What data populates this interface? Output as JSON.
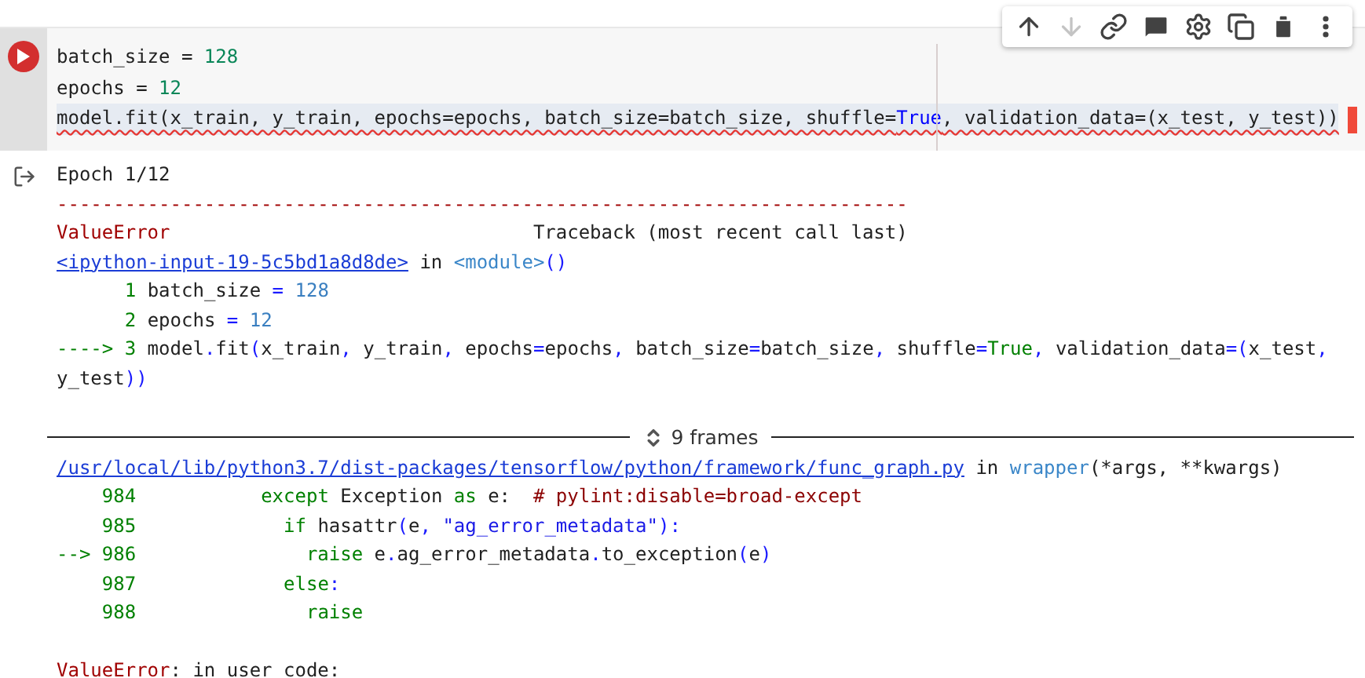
{
  "toolbar": [
    {
      "kind": "up",
      "disabled": false
    },
    {
      "kind": "down",
      "disabled": true
    },
    {
      "kind": "link",
      "disabled": false
    },
    {
      "kind": "comment",
      "disabled": false
    },
    {
      "kind": "settings",
      "disabled": false
    },
    {
      "kind": "mirror",
      "disabled": false
    },
    {
      "kind": "delete",
      "disabled": false
    },
    {
      "kind": "more",
      "disabled": false
    }
  ],
  "cell": {
    "lines": [
      {
        "highlighted": false,
        "squiggle": false,
        "segments": [
          {
            "text": "batch_size = ",
            "kind": "plain"
          },
          {
            "text": "128",
            "kind": "cnumber"
          }
        ]
      },
      {
        "highlighted": false,
        "squiggle": false,
        "segments": [
          {
            "text": "epochs = ",
            "kind": "plain"
          },
          {
            "text": "12",
            "kind": "cnumber"
          }
        ]
      },
      {
        "highlighted": true,
        "squiggle": true,
        "segments": [
          {
            "text": "model.fit(x_train, y_train, epochs=epochs, batch_size=batch_size, shuffle=",
            "kind": "plain"
          },
          {
            "text": "True",
            "kind": "cconst"
          },
          {
            "text": ", validation_data=(x_test, y_test))",
            "kind": "plain"
          }
        ]
      }
    ]
  },
  "output": {
    "lines": [
      {
        "kind": "code",
        "segments": [
          {
            "text": "Epoch 1/12",
            "kind": "plain"
          }
        ]
      },
      {
        "kind": "code",
        "segments": [
          {
            "text": "---------------------------------------------------------------------------",
            "kind": "error"
          }
        ]
      },
      {
        "kind": "code",
        "segments": [
          {
            "text": "ValueError",
            "kind": "error"
          },
          {
            "text": "                                Traceback (most recent call last)",
            "kind": "plain"
          }
        ]
      },
      {
        "kind": "code",
        "segments": [
          {
            "text": "<ipython-input-19-5c5bd1a8d8de>",
            "kind": "link"
          },
          {
            "text": " in ",
            "kind": "plain"
          },
          {
            "text": "<module>",
            "kind": "module"
          },
          {
            "text": "()",
            "kind": "op"
          }
        ]
      },
      {
        "kind": "code",
        "segments": [
          {
            "text": "      1",
            "kind": "lineno"
          },
          {
            "text": " batch_size ",
            "kind": "plain"
          },
          {
            "text": "=",
            "kind": "op"
          },
          {
            "text": " 128",
            "kind": "number"
          }
        ]
      },
      {
        "kind": "code",
        "segments": [
          {
            "text": "      2",
            "kind": "lineno"
          },
          {
            "text": " epochs ",
            "kind": "plain"
          },
          {
            "text": "=",
            "kind": "op"
          },
          {
            "text": " 12",
            "kind": "number"
          }
        ]
      },
      {
        "kind": "code",
        "segments": [
          {
            "text": "----> 3",
            "kind": "lineno"
          },
          {
            "text": " model",
            "kind": "plain"
          },
          {
            "text": ".",
            "kind": "op"
          },
          {
            "text": "fit",
            "kind": "plain"
          },
          {
            "text": "(",
            "kind": "op"
          },
          {
            "text": "x_train",
            "kind": "plain"
          },
          {
            "text": ",",
            "kind": "op"
          },
          {
            "text": " y_train",
            "kind": "plain"
          },
          {
            "text": ",",
            "kind": "op"
          },
          {
            "text": " epochs",
            "kind": "plain"
          },
          {
            "text": "=",
            "kind": "op"
          },
          {
            "text": "epochs",
            "kind": "plain"
          },
          {
            "text": ",",
            "kind": "op"
          },
          {
            "text": " batch_size",
            "kind": "plain"
          },
          {
            "text": "=",
            "kind": "op"
          },
          {
            "text": "batch_size",
            "kind": "plain"
          },
          {
            "text": ",",
            "kind": "op"
          },
          {
            "text": " shuffle",
            "kind": "plain"
          },
          {
            "text": "=",
            "kind": "op"
          },
          {
            "text": "True",
            "kind": "keyword"
          },
          {
            "text": ",",
            "kind": "op"
          },
          {
            "text": " validation_data",
            "kind": "plain"
          },
          {
            "text": "=",
            "kind": "op"
          },
          {
            "text": "(",
            "kind": "op"
          },
          {
            "text": "x_test",
            "kind": "plain"
          },
          {
            "text": ",",
            "kind": "op"
          },
          {
            "text": " y_test",
            "kind": "plain"
          },
          {
            "text": "))",
            "kind": "op"
          }
        ]
      },
      {
        "kind": "blank"
      },
      {
        "kind": "frames",
        "label": "9 frames"
      },
      {
        "kind": "code",
        "segments": [
          {
            "text": "/usr/local/lib/python3.7/dist-packages/tensorflow/python/framework/func_graph.py",
            "kind": "link"
          },
          {
            "text": " in ",
            "kind": "plain"
          },
          {
            "text": "wrapper",
            "kind": "module"
          },
          {
            "text": "(*args, **kwargs)",
            "kind": "plain"
          }
        ]
      },
      {
        "kind": "code",
        "segments": [
          {
            "text": "    984",
            "kind": "lineno"
          },
          {
            "text": "           except",
            "kind": "keyword"
          },
          {
            "text": " Exception ",
            "kind": "plain"
          },
          {
            "text": "as",
            "kind": "keyword"
          },
          {
            "text": " e:  ",
            "kind": "plain"
          },
          {
            "text": "# pylint:disable=broad-except",
            "kind": "comment"
          }
        ]
      },
      {
        "kind": "code",
        "segments": [
          {
            "text": "    985",
            "kind": "lineno"
          },
          {
            "text": "             if",
            "kind": "keyword"
          },
          {
            "text": " hasattr",
            "kind": "plain"
          },
          {
            "text": "(",
            "kind": "op"
          },
          {
            "text": "e",
            "kind": "plain"
          },
          {
            "text": ", ",
            "kind": "op"
          },
          {
            "text": "\"ag_error_metadata\"",
            "kind": "string"
          },
          {
            "text": "):",
            "kind": "op"
          }
        ]
      },
      {
        "kind": "code",
        "segments": [
          {
            "text": "--> 986",
            "kind": "lineno"
          },
          {
            "text": "               raise",
            "kind": "keyword"
          },
          {
            "text": " e",
            "kind": "plain"
          },
          {
            "text": ".",
            "kind": "op"
          },
          {
            "text": "ag_error_metadata",
            "kind": "plain"
          },
          {
            "text": ".",
            "kind": "op"
          },
          {
            "text": "to_exception",
            "kind": "plain"
          },
          {
            "text": "(",
            "kind": "op"
          },
          {
            "text": "e",
            "kind": "plain"
          },
          {
            "text": ")",
            "kind": "op"
          }
        ]
      },
      {
        "kind": "code",
        "segments": [
          {
            "text": "    987",
            "kind": "lineno"
          },
          {
            "text": "             else",
            "kind": "keyword"
          },
          {
            "text": ":",
            "kind": "op"
          }
        ]
      },
      {
        "kind": "code",
        "segments": [
          {
            "text": "    988",
            "kind": "lineno"
          },
          {
            "text": "               raise",
            "kind": "keyword"
          }
        ]
      },
      {
        "kind": "blank"
      },
      {
        "kind": "code",
        "segments": [
          {
            "text": "ValueError",
            "kind": "error"
          },
          {
            "text": ": in user code:",
            "kind": "plain"
          }
        ]
      }
    ]
  }
}
